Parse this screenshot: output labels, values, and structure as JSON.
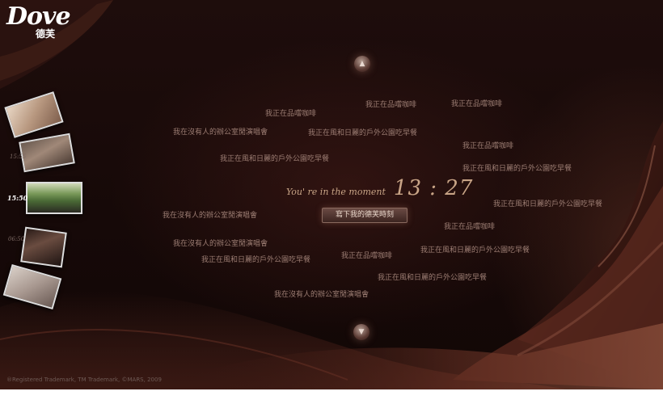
{
  "brand": {
    "wordmark": "Dove",
    "chinese": "德芙"
  },
  "nav": {
    "up_icon": "▲",
    "down_icon": "▼"
  },
  "phrases": [
    "我正在品嚐咖啡",
    "我正在品嚐咖啡",
    "我正在品嚐咖啡",
    "我在沒有人的辦公室閒演唱會",
    "我正在風和日麗的戶外公園吃早餐",
    "我正在品嚐咖啡",
    "我正在風和日麗的戶外公園吃早餐",
    "我正在風和日麗的戶外公園吃早餐",
    "我正在風和日麗的戶外公園吃早餐",
    "我在沒有人的辦公室閒演唱會",
    "我正在品嚐咖啡",
    "我在沒有人的辦公室閒演唱會",
    "我正在風和日麗的戶外公園吃早餐",
    "我正在風和日麗的戶外公園吃早餐",
    "我正在品嚐咖啡",
    "我正在風和日麗的戶外公園吃早餐",
    "我在沒有人的辦公室閒演唱會"
  ],
  "moment": {
    "label": "You' re in the moment",
    "time": "13 : 27"
  },
  "write_button": "寫下我的德芙時刻",
  "timeline": [
    {
      "time": ""
    },
    {
      "time": "15:55"
    },
    {
      "time": "15:50"
    },
    {
      "time": "06:50"
    },
    {
      "time": ""
    }
  ],
  "footer": "®Registered Trademark, TM Trademark, ©MARS, 2009"
}
